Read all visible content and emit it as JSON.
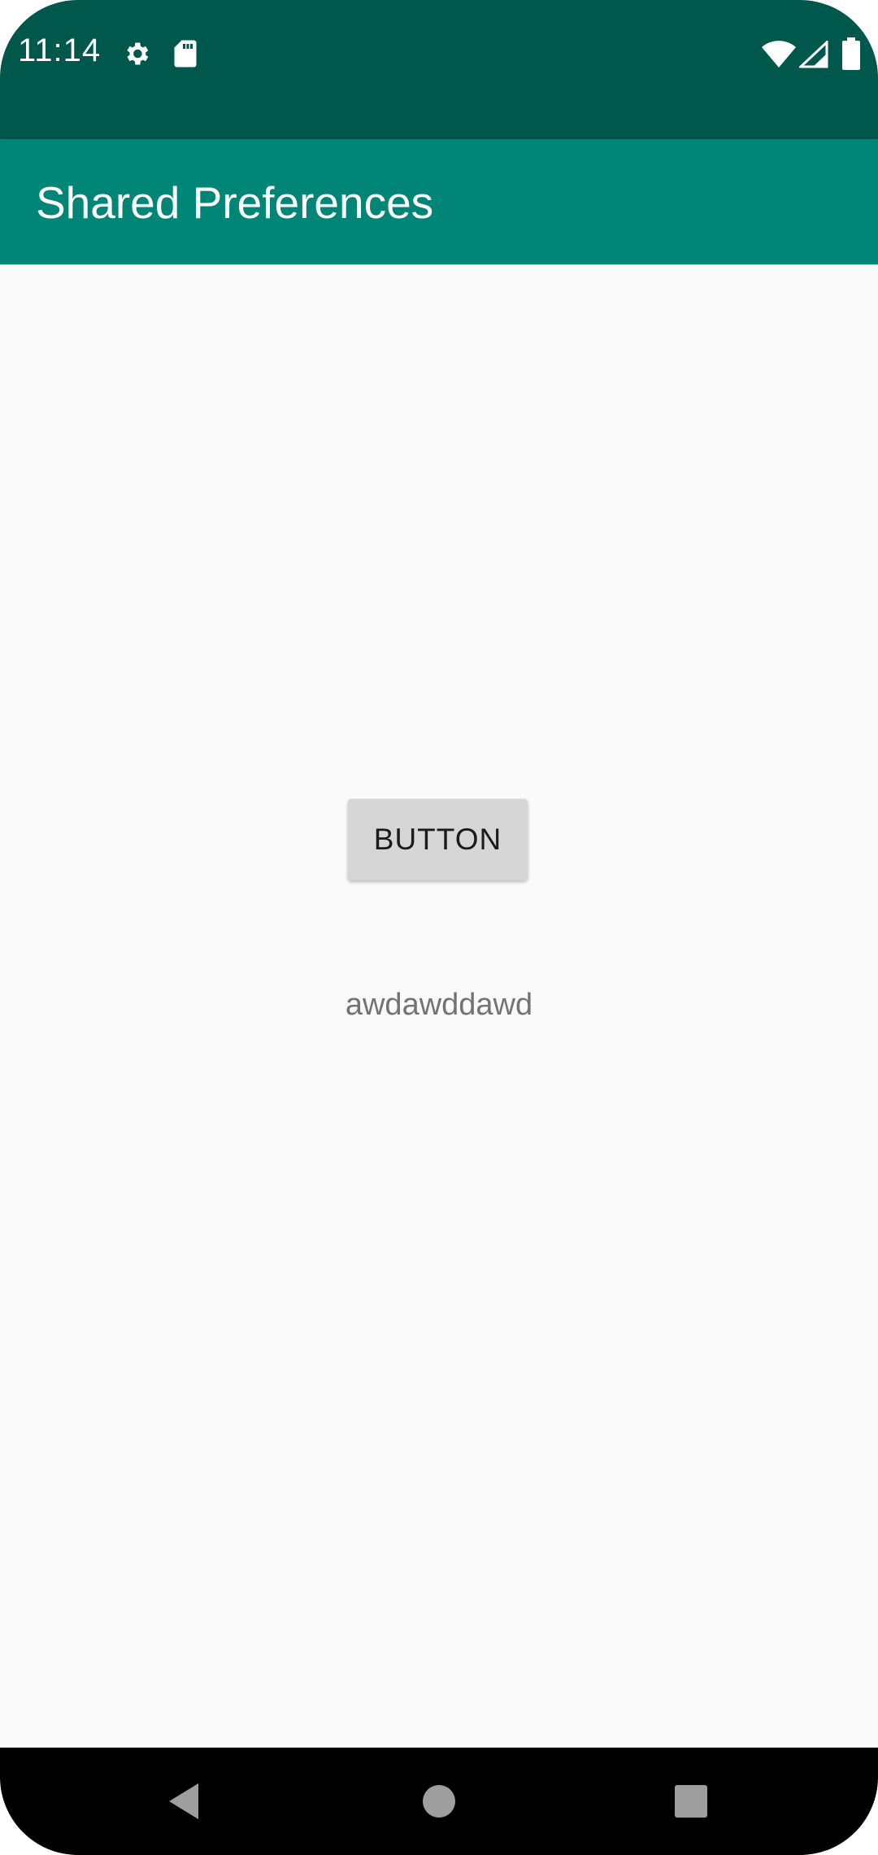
{
  "status_bar": {
    "time": "11:14",
    "icons": [
      "gear-icon",
      "sd-card-icon",
      "wifi-icon",
      "signal-icon",
      "battery-icon"
    ],
    "color": "#00574b"
  },
  "app_bar": {
    "title": "Shared Preferences",
    "color": "#008577"
  },
  "main": {
    "button_label": "BUTTON",
    "text_value": "awdawddawd"
  },
  "nav_bar": {
    "buttons": [
      "back-icon",
      "home-icon",
      "recents-icon"
    ]
  }
}
